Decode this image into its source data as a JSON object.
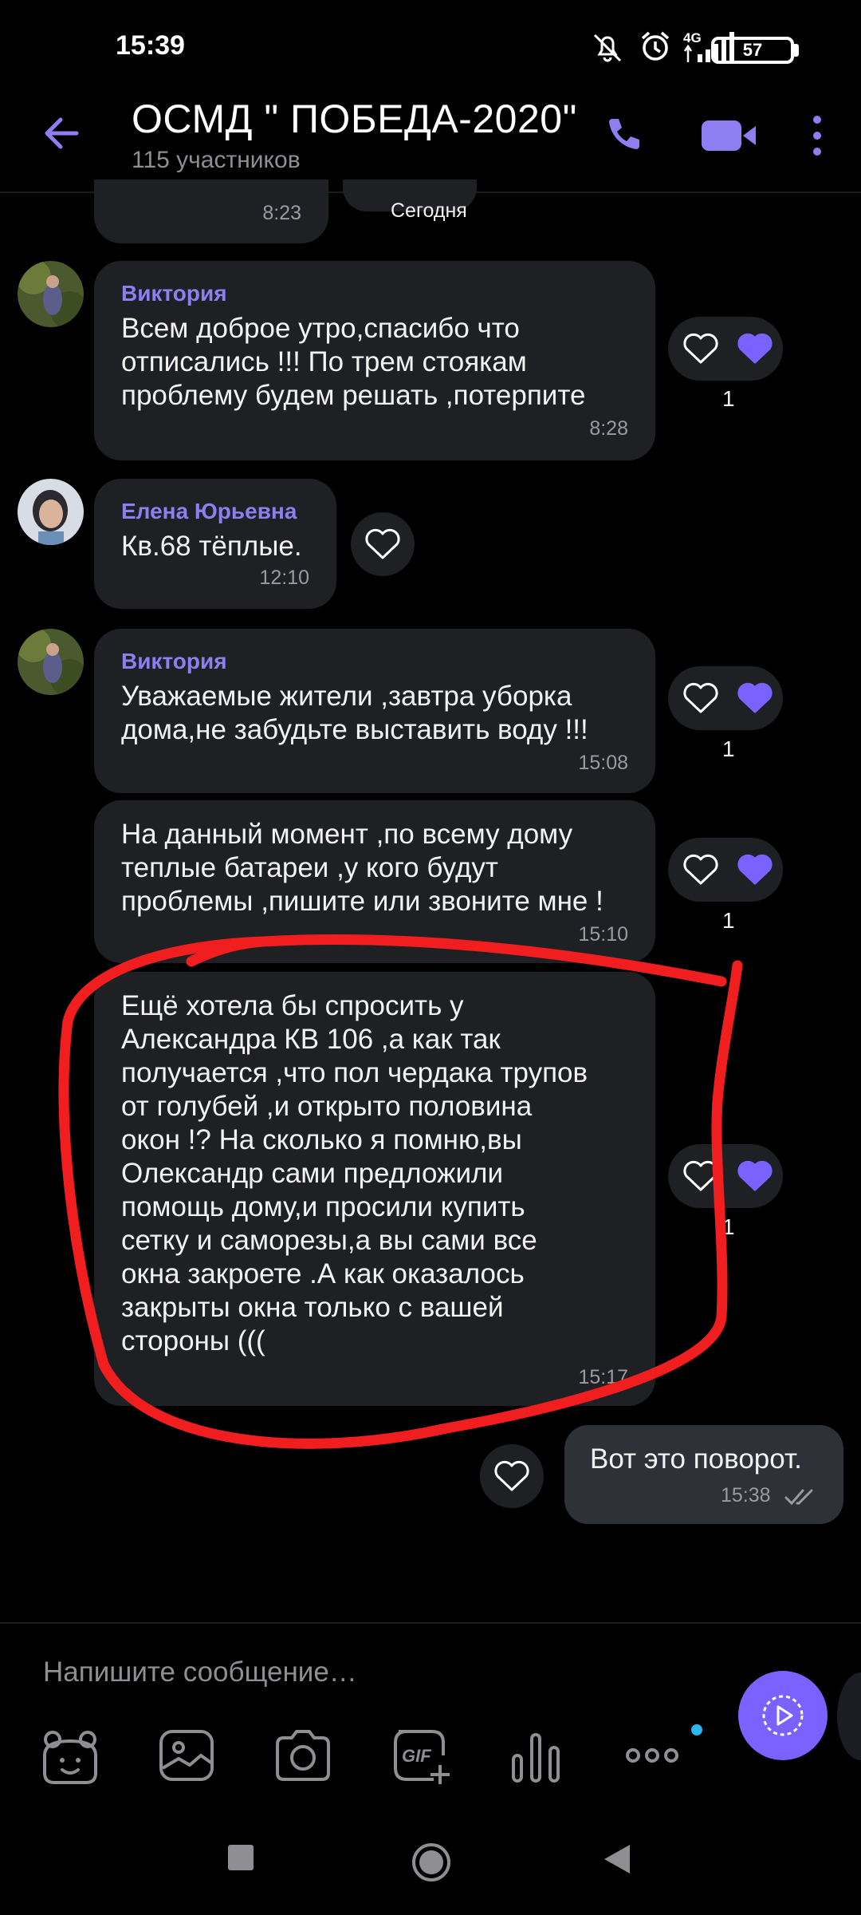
{
  "status_bar": {
    "time": "15:39",
    "network": "4G",
    "battery": "57"
  },
  "header": {
    "back_icon": "arrow-left-icon",
    "title": "ОСМД \" ПОБЕДА-2020\"",
    "subtitle": "115 участников",
    "call_icon": "phone-icon",
    "video_icon": "video-camera-icon",
    "menu_icon": "more-vertical-icon"
  },
  "messages": [
    {
      "time": "8:23",
      "date_badge": "Сегодня"
    },
    {
      "sender": "Виктория",
      "text": "Всем доброе утро,спасибо что\nотписались !!! По трем стоякам\nпроблему будем решать ,потерпите",
      "time": "8:28",
      "likes": "1"
    },
    {
      "sender": "Елена Юрьевна",
      "text": "Кв.68 тёплые.",
      "time": "12:10"
    },
    {
      "sender": "Виктория",
      "text": "Уважаемые жители ,завтра уборка\nдома,не забудьте выставить воду !!!",
      "time": "15:08",
      "likes": "1"
    },
    {
      "text": "На данный момент ,по всему дому\nтеплые батареи ,у кого будут\nпроблемы ,пишите или звоните мне !",
      "time": "15:10",
      "likes": "1"
    },
    {
      "text": "Ещё хотела бы спросить у\nАлександра КВ 106 ,а как так\nполучается ,что пол чердака трупов\nот голубей ,и открыто половина\nокон !? На сколько я помню,вы\nОлександр сами предложили\nпомощь дому,и просили купить\nсетку и саморезы,а вы сами все\nокна закроете .А как оказалось\nзакрыты окна только с вашей\nстороны (((",
      "time": "15:17",
      "likes": "1"
    },
    {
      "text": "Вот это поворот.",
      "time": "15:38",
      "outgoing": true,
      "status_icon": "double-check-icon"
    }
  ],
  "composer": {
    "placeholder": "Напишите сообщение…",
    "tools": [
      "sticker-bear-icon",
      "gallery-icon",
      "camera-icon",
      "gif-icon",
      "poll-icon",
      "more-horizontal-icon"
    ],
    "send_icon": "voice-record-icon"
  },
  "colors": {
    "accent": "#7b61ff",
    "sender": "#8f7ef2",
    "bubble": "#1f2024",
    "outgoing_bubble": "#2e3138",
    "annotation": "#f01e1e"
  }
}
